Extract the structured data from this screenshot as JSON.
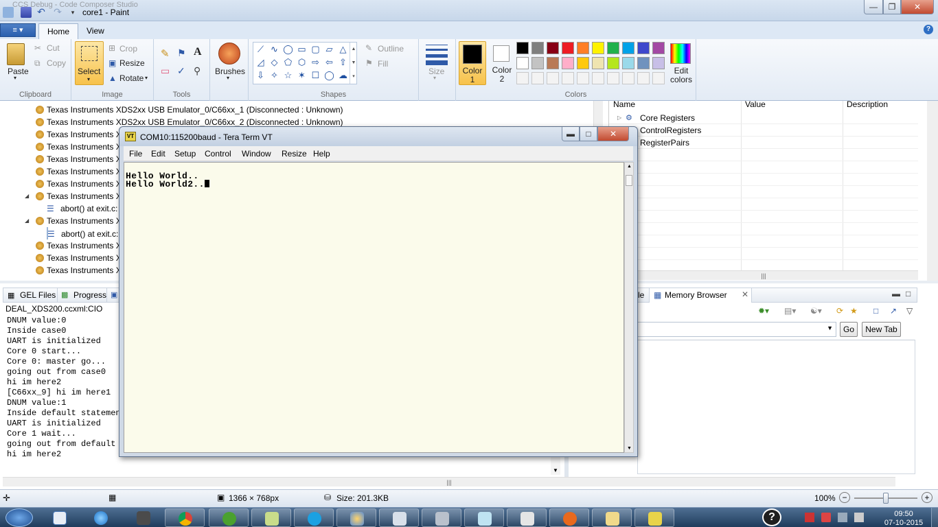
{
  "paint": {
    "title": "core1 - Paint",
    "ghost_title": "CCS Debug - Code Composer Studio",
    "file_button": "≡ ▾",
    "tabs": [
      "Home",
      "View"
    ],
    "help_icon": "?",
    "ribbon": {
      "clipboard": {
        "paste": "Paste",
        "cut": "Cut",
        "copy": "Copy",
        "label": "Clipboard"
      },
      "image": {
        "select": "Select",
        "crop": "Crop",
        "resize": "Resize",
        "rotate": "Rotate",
        "label": "Image"
      },
      "tools": {
        "label": "Tools"
      },
      "brushes": {
        "label": "Brushes"
      },
      "shapes": {
        "outline": "Outline",
        "fill": "Fill",
        "label": "Shapes"
      },
      "size": {
        "label": "Size"
      },
      "colors": {
        "color1": "Color 1",
        "color2": "Color 2",
        "edit": "Edit colors",
        "label": "Colors",
        "color1_value": "#000000",
        "color2_value": "#ffffff",
        "palette_row1": [
          "#000000",
          "#7f7f7f",
          "#880015",
          "#ed1c24",
          "#ff7f27",
          "#fff200",
          "#22b14c",
          "#00a2e8",
          "#3f48cc",
          "#a349a4"
        ],
        "palette_row2": [
          "#ffffff",
          "#c3c3c3",
          "#b97a57",
          "#ffaec9",
          "#ffc90e",
          "#efe4b0",
          "#b5e61d",
          "#99d9ea",
          "#7092be",
          "#c8bfe7"
        ]
      }
    },
    "status": {
      "dimensions": "1366 × 768px",
      "size": "Size: 201.3KB",
      "zoom": "100%",
      "zoom_level": 0.5
    }
  },
  "debug": {
    "tree": [
      "Texas Instruments XDS2xx USB Emulator_0/C66xx_1 (Disconnected : Unknown)",
      "Texas Instruments XDS2xx USB Emulator_0/C66xx_2 (Disconnected : Unknown)",
      "Texas Instruments X",
      "Texas Instruments X",
      "Texas Instruments X",
      "Texas Instruments X",
      "Texas Instruments X",
      "Texas Instruments X",
      "abort() at exit.c:",
      "Texas Instruments X",
      "abort() at exit.c:",
      "Texas Instruments X",
      "Texas Instruments X",
      "Texas Instruments X"
    ],
    "registers": {
      "headers": [
        "Name",
        "Value",
        "Description"
      ],
      "rows": [
        "Core Registers",
        "ControlRegisters",
        "RegisterPairs"
      ]
    },
    "console_tabs": [
      "GEL Files",
      "Progress"
    ],
    "console_title": "DEAL_XDS200.ccxml:CIO",
    "console_lines": [
      "DNUM value:0",
      "Inside case0",
      "UART is initialized",
      "Core 0 start...",
      "Core 0: master go...",
      "going out from case0",
      "hi im here2",
      "[C66xx_9] hi im here1",
      "DNUM value:1",
      "Inside default statemen",
      "UART is initialized",
      "Core 1 wait...",
      "going out from default c",
      "hi im here2"
    ],
    "memory": {
      "partial_tab": "le",
      "tab": "Memory Browser",
      "go": "Go",
      "new_tab": "New Tab"
    }
  },
  "teraterm": {
    "title": "COM10:115200baud - Tera Term VT",
    "menu": [
      "File",
      "Edit",
      "Setup",
      "Control",
      "Window",
      "Resize",
      "Help"
    ],
    "lines": [
      "Hello World..",
      "Hello World2.."
    ]
  },
  "taskbar": {
    "clock_time": "09:50",
    "clock_date": "07-10-2015"
  }
}
